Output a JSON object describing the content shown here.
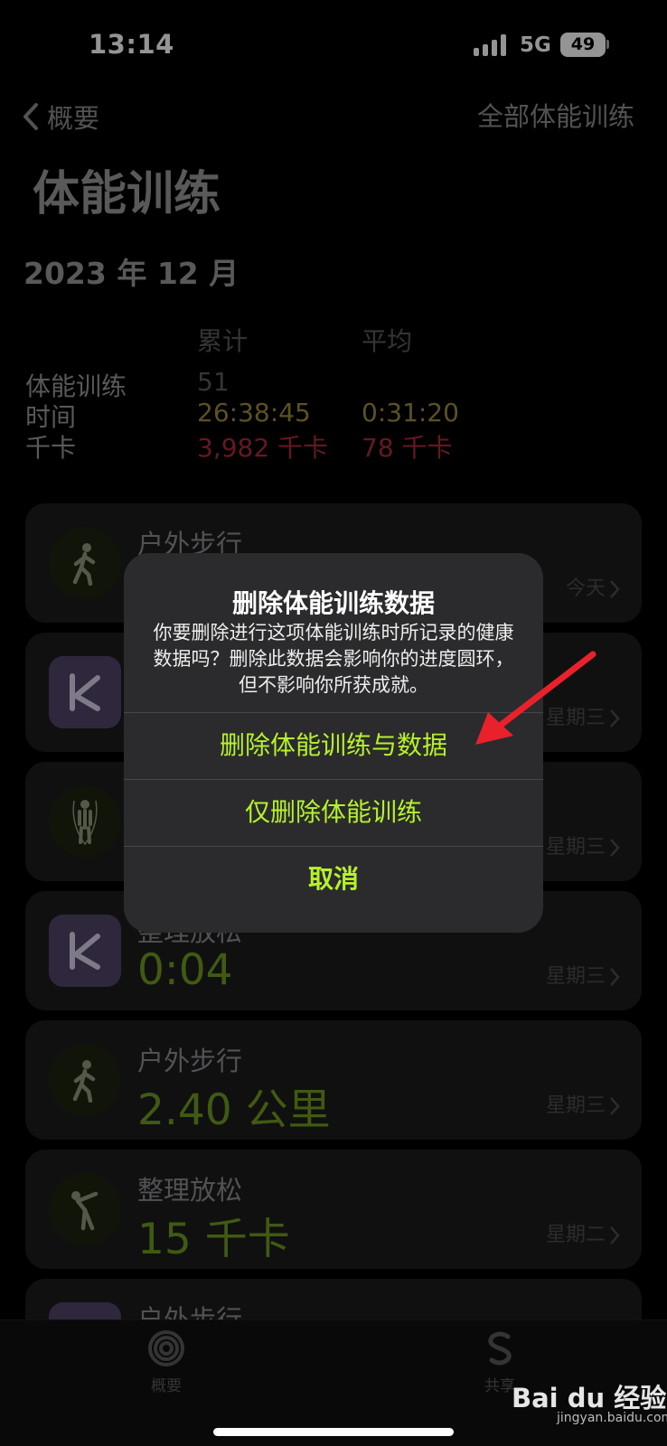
{
  "status_bar": {
    "time": "13:14",
    "network": "5G",
    "battery": "49"
  },
  "nav": {
    "back_label": "概要",
    "right_label": "全部体能训练"
  },
  "page_title": "体能训练",
  "month": "2023 年 12 月",
  "summary": {
    "col_total": "累计",
    "col_avg": "平均",
    "rows": [
      {
        "label": "体能训练",
        "total": "51",
        "avg": ""
      },
      {
        "label": "时间",
        "total": "26:38:45",
        "avg": "0:31:20"
      },
      {
        "label": "千卡",
        "total": "3,982 千卡",
        "avg": "78 千卡"
      }
    ]
  },
  "workouts": [
    {
      "icon": "walking-icon",
      "type": "户外步行",
      "value": "",
      "day": "今天"
    },
    {
      "icon": "keep-app-icon",
      "type": "",
      "value": "",
      "day": "星期三"
    },
    {
      "icon": "jump-rope-icon",
      "type": "",
      "value": "",
      "day": "星期三"
    },
    {
      "icon": "keep-app-icon",
      "type": "整理放松",
      "value": "0:04",
      "day": "星期三"
    },
    {
      "icon": "walking-icon",
      "type": "户外步行",
      "value": "2.40 公里",
      "day": "星期三"
    },
    {
      "icon": "stretching-icon",
      "type": "整理放松",
      "value": "15 千卡",
      "day": "星期二"
    },
    {
      "icon": "keep-app-icon",
      "type": "户外步行",
      "value": "",
      "day": ""
    }
  ],
  "dialog": {
    "title": "删除体能训练数据",
    "message": "你要删除进行这项体能训练时所记录的健康数据吗？删除此数据会影响你的进度圆环，但不影响你所获成就。",
    "delete_all_label": "删除体能训练与数据",
    "delete_workout_label": "仅删除体能训练",
    "cancel_label": "取消"
  },
  "tabbar": {
    "summary_label": "概要",
    "sharing_label": "共享"
  },
  "watermark": {
    "brand": "Bai du 经验",
    "url": "jingyan.baidu.com"
  },
  "colors": {
    "accent_green": "#b6f22a",
    "time_gold": "#a08a3c",
    "calorie_red": "#b0283c",
    "metric_green": "#6e9b22",
    "annotation_red": "#e8212b"
  }
}
